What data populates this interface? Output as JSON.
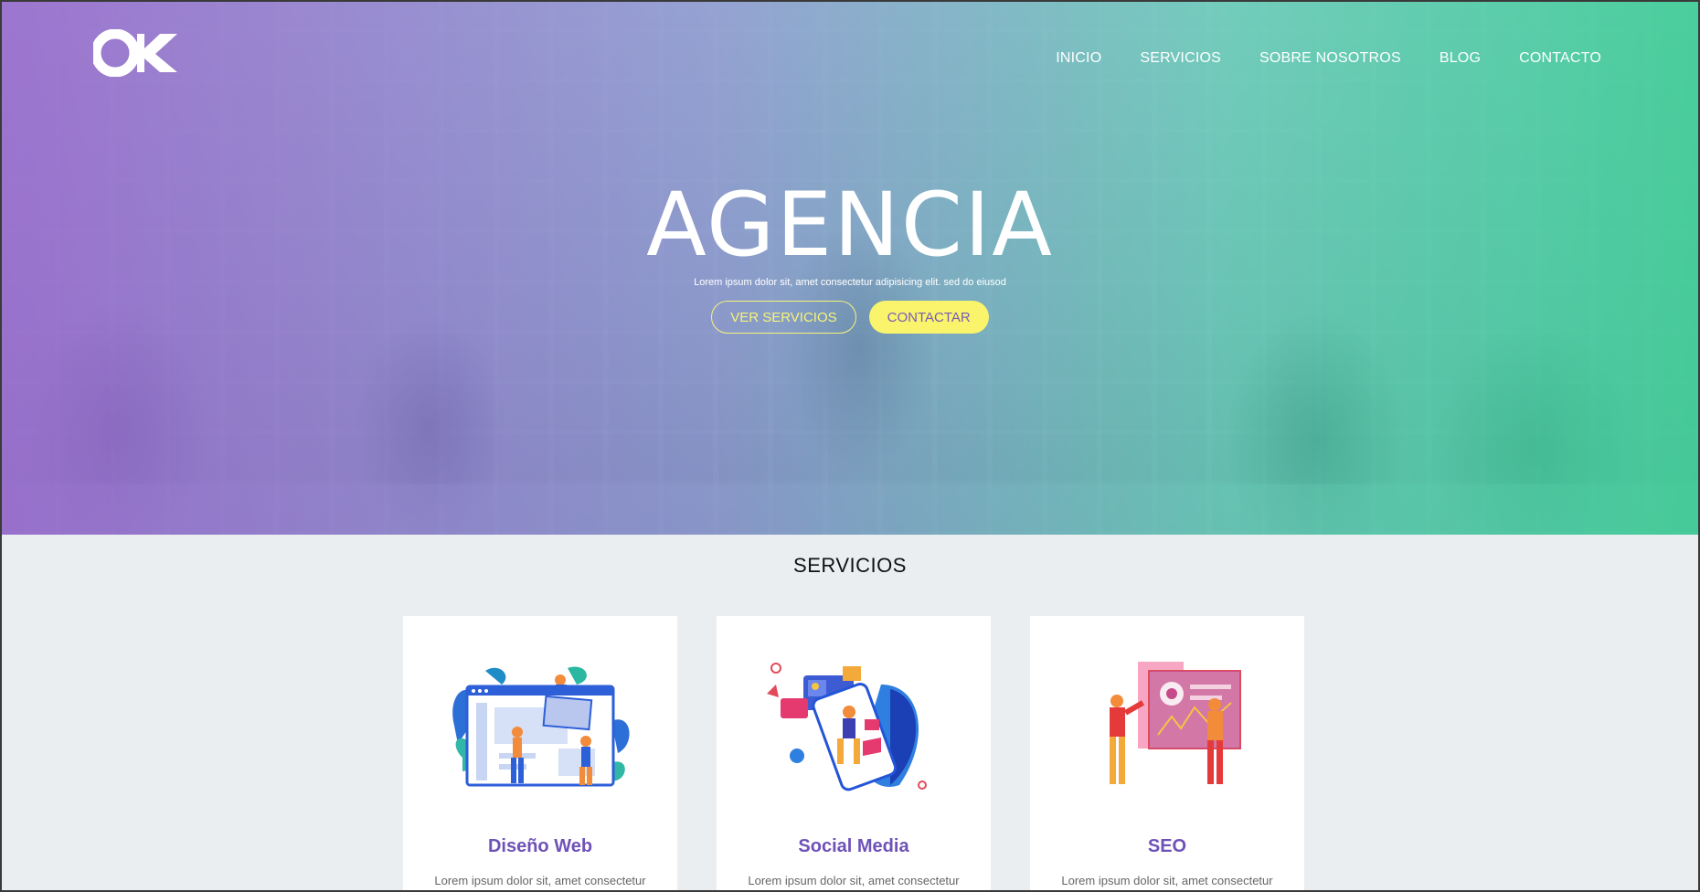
{
  "brand": {
    "logo_text": "OK"
  },
  "nav": {
    "items": [
      "INICIO",
      "SERVICIOS",
      "SOBRE NOSOTROS",
      "BLOG",
      "CONTACTO"
    ]
  },
  "hero": {
    "title": "AGENCIA",
    "subtitle": "Lorem ipsum dolor sit, amet consectetur adipisicing elit. sed do eiusod",
    "buttons": {
      "services": "VER SERVICIOS",
      "contact": "CONTACTAR"
    }
  },
  "services": {
    "title": "SERVICIOS",
    "cards": [
      {
        "title": "Diseño Web",
        "text": "Lorem ipsum dolor sit, amet consectetur",
        "illustration": "web-design-illustration"
      },
      {
        "title": "Social Media",
        "text": "Lorem ipsum dolor sit, amet consectetur",
        "illustration": "social-media-illustration"
      },
      {
        "title": "SEO",
        "text": "Lorem ipsum dolor sit, amet consectetur",
        "illustration": "seo-illustration"
      }
    ]
  },
  "colors": {
    "gradient_left": "#9668cd",
    "gradient_right": "#3ccd96",
    "accent_yellow": "#f9f46b",
    "card_title_purple": "#6f52b8",
    "page_bg": "#eaeef1"
  }
}
